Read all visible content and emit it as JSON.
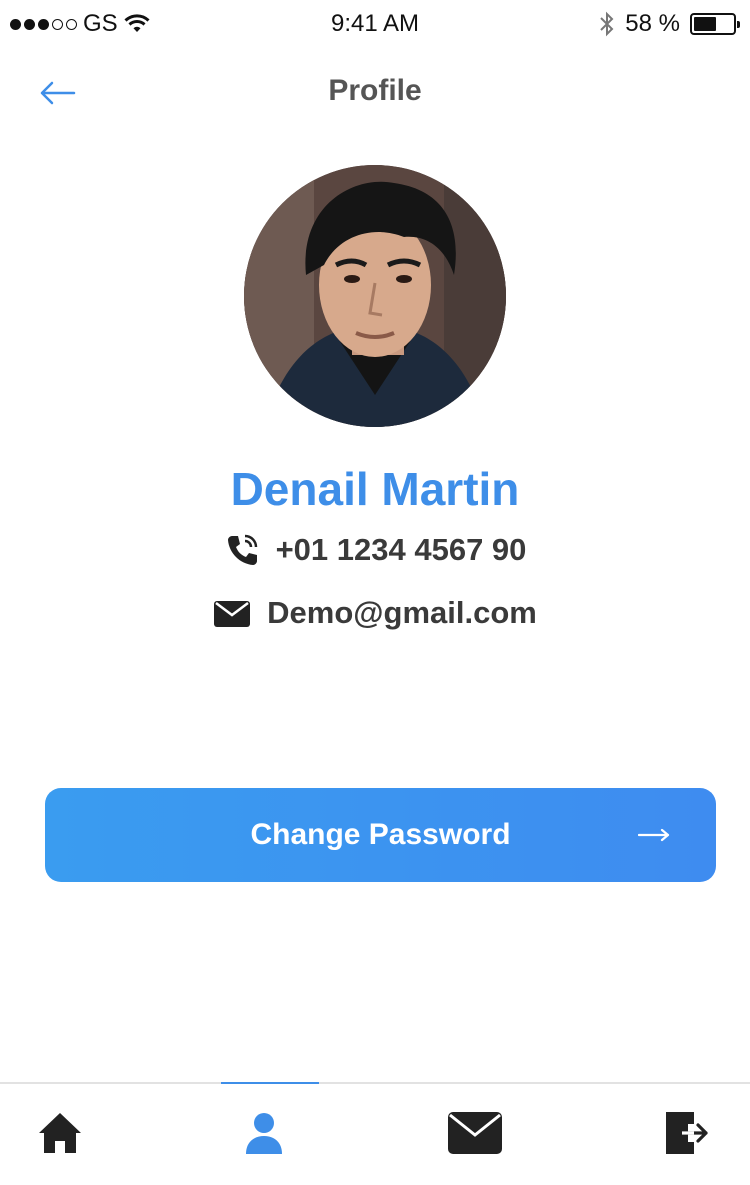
{
  "status_bar": {
    "carrier": "GS",
    "time": "9:41 AM",
    "battery_percent": "58 %",
    "battery_level": 0.58
  },
  "header": {
    "title": "Profile",
    "back_icon": "arrow-left-icon"
  },
  "profile": {
    "name": "Denail Martin",
    "phone": "+01 1234 4567 90",
    "email": "Demo@gmail.com",
    "phone_icon": "phone-icon",
    "email_icon": "envelope-icon"
  },
  "actions": {
    "change_password_label": "Change Password",
    "change_password_icon": "arrow-right-icon"
  },
  "tab_bar": {
    "active_index": 1,
    "tabs": [
      {
        "icon": "home-icon"
      },
      {
        "icon": "user-icon"
      },
      {
        "icon": "mail-icon"
      },
      {
        "icon": "logout-icon"
      }
    ]
  },
  "colors": {
    "accent": "#3e8ee8",
    "text_dark": "#3a3a3a",
    "button_gradient_start": "#3a9cf0",
    "button_gradient_end": "#3e8cf0"
  }
}
